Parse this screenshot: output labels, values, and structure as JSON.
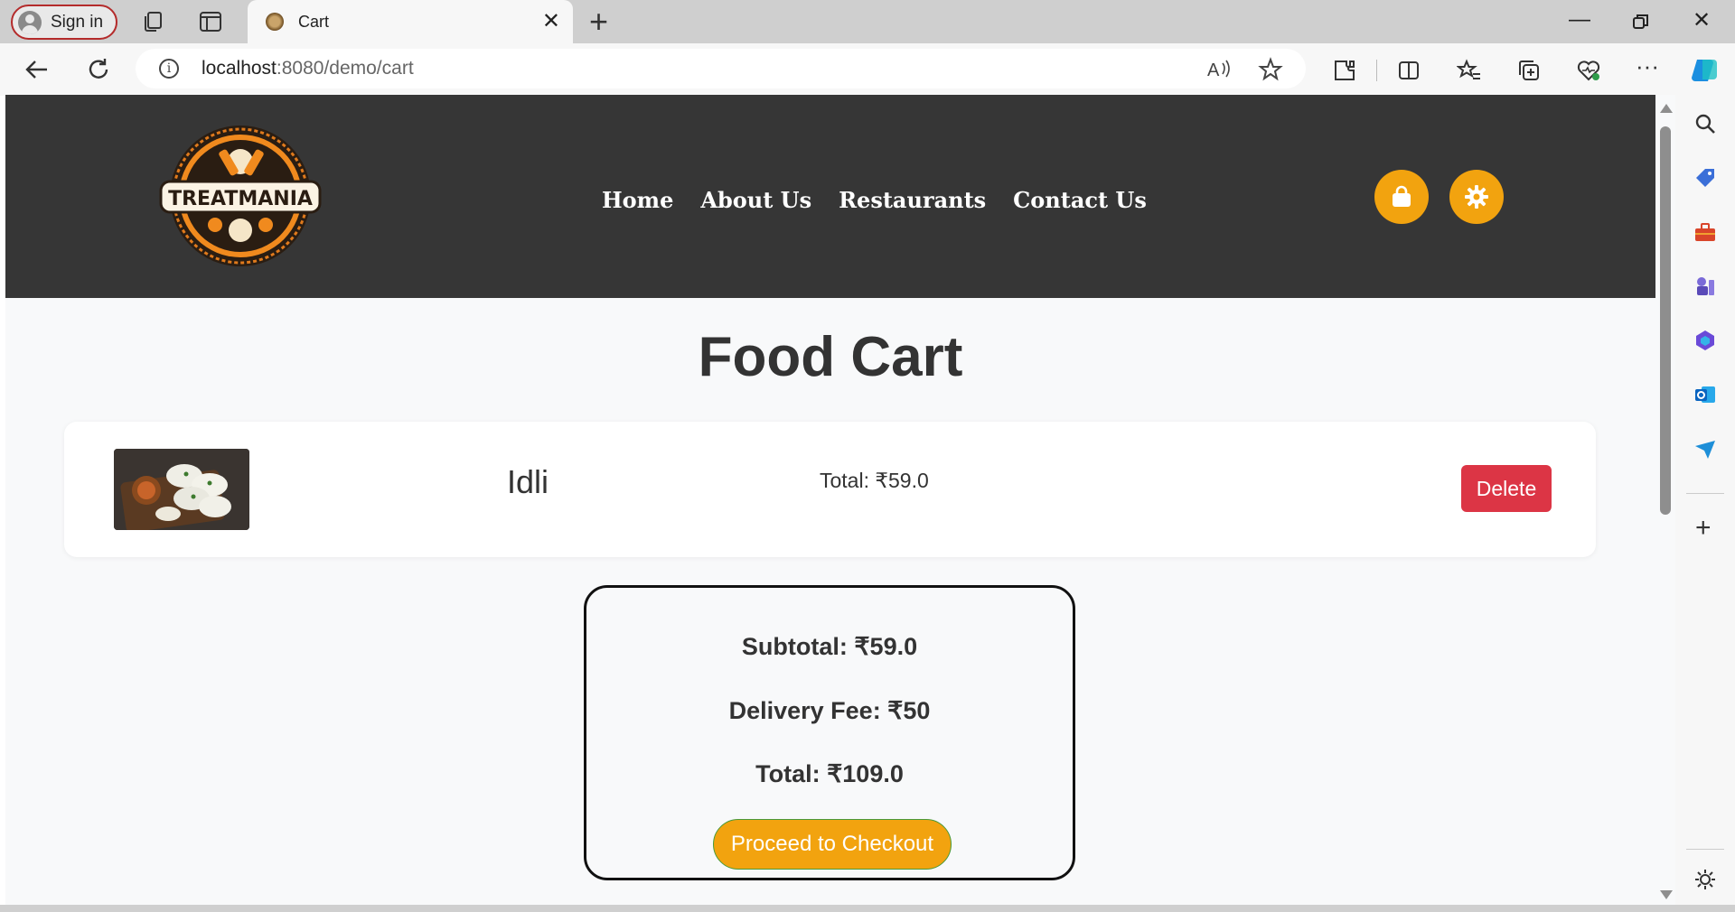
{
  "browser": {
    "signin_label": "Sign in",
    "tab_title": "Cart",
    "url_host": "localhost",
    "url_rest": ":8080/demo/cart"
  },
  "site": {
    "logo_text": "TREATMANIA",
    "nav": [
      "Home",
      "About Us",
      "Restaurants",
      "Contact Us"
    ],
    "accent_color": "#f2a30f",
    "header_color": "#363636"
  },
  "cart": {
    "title": "Food Cart",
    "items": [
      {
        "name": "Idli",
        "total": "Total: ₹59.0",
        "delete_label": "Delete"
      }
    ],
    "summary": {
      "subtotal": "Subtotal: ₹59.0",
      "delivery_fee": "Delivery Fee: ₹50",
      "total": "Total: ₹109.0",
      "checkout_label": "Proceed to Checkout"
    }
  }
}
